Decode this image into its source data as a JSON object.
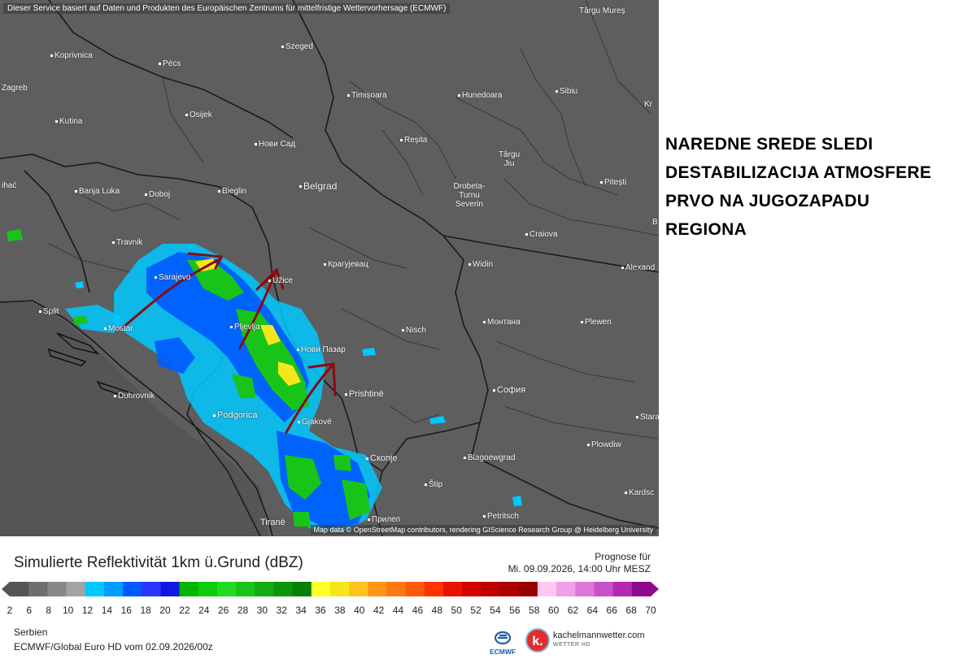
{
  "map": {
    "credit_top": "Dieser Service basiert auf Daten und Produkten des Europäischen Zentrums für mittelfristige Wettervorhersage (ECMWF)",
    "credit_bottom": "Map data © OpenStreetMap contributors, rendering GIScience Research Group @ Heidelberg University",
    "background_color": "#5e5e5e",
    "cities": [
      {
        "name": "Târgu Mureș",
        "id": "targu-mures"
      },
      {
        "name": "Koprivnica",
        "id": "koprivnica"
      },
      {
        "name": "Pécs",
        "id": "pecs"
      },
      {
        "name": "Szeged",
        "id": "szeged"
      },
      {
        "name": "Zagreb",
        "id": "zagreb"
      },
      {
        "name": "Timișoara",
        "id": "timisoara"
      },
      {
        "name": "Hunedoara",
        "id": "hunedoara"
      },
      {
        "name": "Sibiu",
        "id": "sibiu"
      },
      {
        "name": "Kr",
        "id": "kr"
      },
      {
        "name": "Kutina",
        "id": "kutina"
      },
      {
        "name": "Osijek",
        "id": "osijek"
      },
      {
        "name": "Нови Сад",
        "id": "novi-sad"
      },
      {
        "name": "Reșita",
        "id": "resita"
      },
      {
        "name": "Târgu Jiu",
        "id": "targu-jiu"
      },
      {
        "name": "ihać",
        "id": "bihac"
      },
      {
        "name": "Banja Luka",
        "id": "banja-luka"
      },
      {
        "name": "Doboj",
        "id": "doboj"
      },
      {
        "name": "Bieglin",
        "id": "bieglin"
      },
      {
        "name": "Belgrad",
        "id": "belgrad"
      },
      {
        "name": "Drobeta-Turnu Severin",
        "id": "drobeta"
      },
      {
        "name": "Pitești",
        "id": "pitesti"
      },
      {
        "name": "B",
        "id": "b"
      },
      {
        "name": "Craiova",
        "id": "craiova"
      },
      {
        "name": "Travnik",
        "id": "travnik"
      },
      {
        "name": "Sarajevo",
        "id": "sarajevo"
      },
      {
        "name": "Užice",
        "id": "uzice"
      },
      {
        "name": "Крагујевац",
        "id": "kragujevac"
      },
      {
        "name": "Widin",
        "id": "widin"
      },
      {
        "name": "Alexand",
        "id": "alexand"
      },
      {
        "name": "Split",
        "id": "split"
      },
      {
        "name": "Mostar",
        "id": "mostar"
      },
      {
        "name": "Pljevlja",
        "id": "pljevlja"
      },
      {
        "name": "Монтана",
        "id": "montana"
      },
      {
        "name": "Plewen",
        "id": "plewen"
      },
      {
        "name": "Nisch",
        "id": "nisch"
      },
      {
        "name": "Нови Пазар",
        "id": "novi-pazar"
      },
      {
        "name": "Dubrovnik",
        "id": "dubrovnik"
      },
      {
        "name": "Prishtinë",
        "id": "prishtine"
      },
      {
        "name": "София",
        "id": "sofia"
      },
      {
        "name": "Podgorica",
        "id": "podgorica"
      },
      {
        "name": "Gjakovë",
        "id": "gjakove"
      },
      {
        "name": "Stara",
        "id": "stara"
      },
      {
        "name": "Plowdiw",
        "id": "plowdiw"
      },
      {
        "name": "Скопје",
        "id": "skopje"
      },
      {
        "name": "Blagoewgrad",
        "id": "blagoewgrad"
      },
      {
        "name": "Štip",
        "id": "stip"
      },
      {
        "name": "Kardsc",
        "id": "kardsc"
      },
      {
        "name": "Tiranë",
        "id": "tirane"
      },
      {
        "name": "Прилеп",
        "id": "prilep"
      },
      {
        "name": "Petritsch",
        "id": "petritsch"
      }
    ]
  },
  "annotation": {
    "lines": [
      "NAREDNE SREDE SLEDI",
      "DESTABILIZACIJA ATMOSFERE",
      "PRVO NA JUGOZAPADU",
      "REGIONA"
    ]
  },
  "legend": {
    "title": "Simulierte Reflektivität 1km ü.Grund (dBZ)",
    "forecast_label": "Prognose für",
    "forecast_time": "Mi. 09.09.2026, 14:00 Uhr MESZ",
    "ticks": [
      "2",
      "6",
      "8",
      "10",
      "12",
      "14",
      "16",
      "18",
      "20",
      "22",
      "24",
      "26",
      "28",
      "30",
      "32",
      "34",
      "36",
      "38",
      "40",
      "42",
      "44",
      "46",
      "48",
      "50",
      "52",
      "54",
      "56",
      "58",
      "60",
      "62",
      "64",
      "66",
      "68",
      "70"
    ],
    "colors": [
      "#555555",
      "#6e6e6e",
      "#888888",
      "#a3a3a3",
      "#00c8ff",
      "#009bff",
      "#005aff",
      "#2a35ff",
      "#1018e0",
      "#00b400",
      "#0ccc0c",
      "#20dc20",
      "#18c418",
      "#10ac10",
      "#0a960a",
      "#068006",
      "#ffff28",
      "#f5e61e",
      "#ffc31e",
      "#ff9614",
      "#ff7814",
      "#ff5a0a",
      "#ff3200",
      "#e61400",
      "#d20000",
      "#be0000",
      "#aa0000",
      "#960000",
      "#ffc8f0",
      "#f0a0e6",
      "#dc78d7",
      "#c850c8",
      "#b428b4",
      "#8c0a8c"
    ],
    "region": "Serbien",
    "model_run": "ECMWF/Global Euro HD vom 02.09.2026/00z",
    "ecmwf_logo_text": "ECMWF",
    "km_url": "kachelmannwetter.com",
    "km_sub": "WETTER HD",
    "km_letter": "k."
  }
}
